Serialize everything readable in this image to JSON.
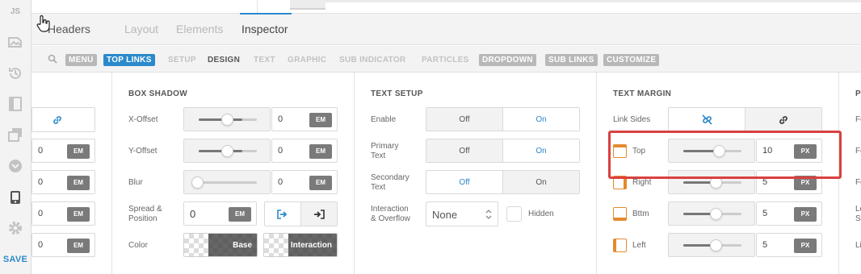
{
  "rail": {
    "js_label": "JS",
    "save_label": "SAVE",
    "icons": [
      "image-icon",
      "history-icon",
      "layout-icon",
      "layers-icon",
      "chevron-circle-icon",
      "mobile-icon",
      "gear-icon"
    ]
  },
  "tabs": {
    "headers": "Headers",
    "layout": "Layout",
    "elements": "Elements",
    "inspector": "Inspector"
  },
  "subnav": {
    "menu": "MENU",
    "top_links": "TOP LINKS",
    "setup": "SETUP",
    "design": "DESIGN",
    "text": "TEXT",
    "graphic": "GRAPHIC",
    "sub_indicator": "SUB INDICATOR",
    "particles": "PARTICLES",
    "dropdown": "DROPDOWN",
    "sub_links": "SUB LINKS",
    "customize": "CUSTOMIZE"
  },
  "left_col": {
    "values": [
      "0",
      "0",
      "0",
      "0"
    ],
    "unit": "EM"
  },
  "box_shadow": {
    "title": "BOX SHADOW",
    "x_offset": {
      "label": "X-Offset",
      "value": "0",
      "unit": "EM",
      "level": 0.75
    },
    "y_offset": {
      "label": "Y-Offset",
      "value": "0",
      "unit": "EM",
      "level": 0.75
    },
    "blur": {
      "label": "Blur",
      "value": "0",
      "unit": "EM",
      "level": 0.0
    },
    "spread": {
      "label_1": "Spread &",
      "label_2": "Position",
      "value": "0",
      "unit": "EM"
    },
    "color": {
      "label": "Color",
      "base": "Base",
      "interaction": "Interaction"
    }
  },
  "text_setup": {
    "title": "TEXT SETUP",
    "enable": {
      "label": "Enable",
      "off": "Off",
      "on": "On"
    },
    "primary": {
      "label_1": "Primary",
      "label_2": "Text",
      "off": "Off",
      "on": "On"
    },
    "secondary": {
      "label_1": "Secondary",
      "label_2": "Text",
      "off": "Off",
      "on": "On"
    },
    "interaction": {
      "label_1": "Interaction",
      "label_2": "& Overflow",
      "select_value": "None",
      "checkbox_label": "Hidden"
    }
  },
  "text_margin": {
    "title": "TEXT MARGIN",
    "link_sides": "Link Sides",
    "top": {
      "label": "Top",
      "value": "10",
      "unit": "PX",
      "level": 0.62
    },
    "right": {
      "label": "Right",
      "value": "5",
      "unit": "PX",
      "level": 0.55
    },
    "bottom": {
      "label": "Bttm",
      "value": "5",
      "unit": "PX",
      "level": 0.55
    },
    "left": {
      "label": "Left",
      "value": "5",
      "unit": "PX",
      "level": 0.55
    }
  },
  "partial_col": {
    "title_fragment": "P",
    "labels": [
      "Fo",
      "Fo",
      "Fo",
      "Le",
      "Sp",
      "Li"
    ]
  },
  "colors": {
    "accent": "#2b8acb",
    "highlight": "#d9413f",
    "margin_icon": "#e58a2e"
  }
}
